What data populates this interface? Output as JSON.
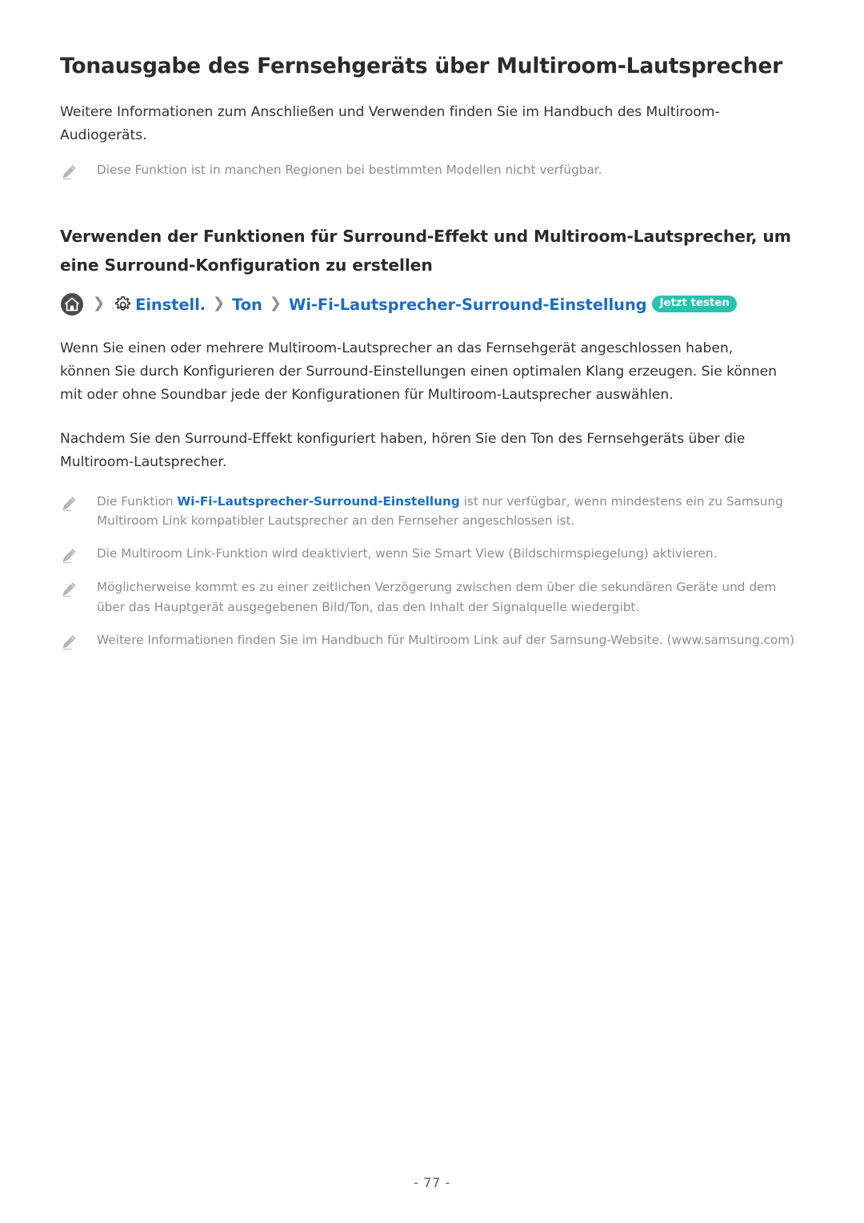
{
  "document": {
    "title": "Tonausgabe des Fernsehgeräts über Multiroom-Lautsprecher",
    "intro_paragraph": "Weitere Informationen zum Anschließen und Verwenden finden Sie im Handbuch des Multiroom-Audiogeräts.",
    "intro_note": "Diese Funktion ist in manchen Regionen bei bestimmten Modellen nicht verfügbar.",
    "page_number": "- 77 -"
  },
  "section": {
    "heading": "Verwenden der Funktionen für Surround-Effekt und Multiroom-Lautsprecher, um eine Surround-Konfiguration zu erstellen",
    "paragraphs": [
      "Wenn Sie einen oder mehrere Multiroom-Lautsprecher an das Fernsehgerät angeschlossen haben, können Sie durch Konfigurieren der Surround-Einstellungen einen optimalen Klang erzeugen. Sie können mit oder ohne Soundbar jede der Konfigurationen für Multiroom-Lautsprecher auswählen.",
      "Nachdem Sie den Surround-Effekt konfiguriert haben, hören Sie den Ton des Fernsehgeräts über die Multiroom-Lautsprecher."
    ]
  },
  "breadcrumb": {
    "home_icon": "home-icon",
    "gear_icon": "gear-icon",
    "separator": "❯",
    "items": [
      {
        "label": "Einstell."
      },
      {
        "label": "Ton"
      },
      {
        "label": "Wi-Fi-Lautsprecher-Surround-Einstellung"
      }
    ],
    "badge": "Jetzt testen"
  },
  "notes": [
    {
      "icon": "pencil-icon",
      "text_before": "Die Funktion ",
      "highlight": "Wi-Fi-Lautsprecher-Surround-Einstellung",
      "text_after": " ist nur verfügbar, wenn mindestens ein zu Samsung Multiroom Link kompatibler Lautsprecher an den Fernseher angeschlossen ist."
    },
    {
      "icon": "pencil-icon",
      "text_before": "Die Multiroom Link-Funktion wird deaktiviert, wenn Sie Smart View (Bildschirmspiegelung) aktivieren.",
      "highlight": "",
      "text_after": ""
    },
    {
      "icon": "pencil-icon",
      "text_before": "Möglicherweise kommt es zu einer zeitlichen Verzögerung zwischen dem über die sekundären Geräte und dem über das Hauptgerät ausgegebenen Bild/Ton, das den Inhalt der Signalquelle wiedergibt.",
      "highlight": "",
      "text_after": ""
    },
    {
      "icon": "pencil-icon",
      "text_before": "Weitere Informationen finden Sie im Handbuch für Multiroom Link auf der Samsung-Website. (www.samsung.com)",
      "highlight": "",
      "text_after": ""
    }
  ],
  "colors": {
    "link": "#1f6dbf",
    "badge_bg": "#28c2ae",
    "note_text": "#8d8d8d",
    "heading": "#2b2b2b",
    "body_text": "#333333"
  }
}
